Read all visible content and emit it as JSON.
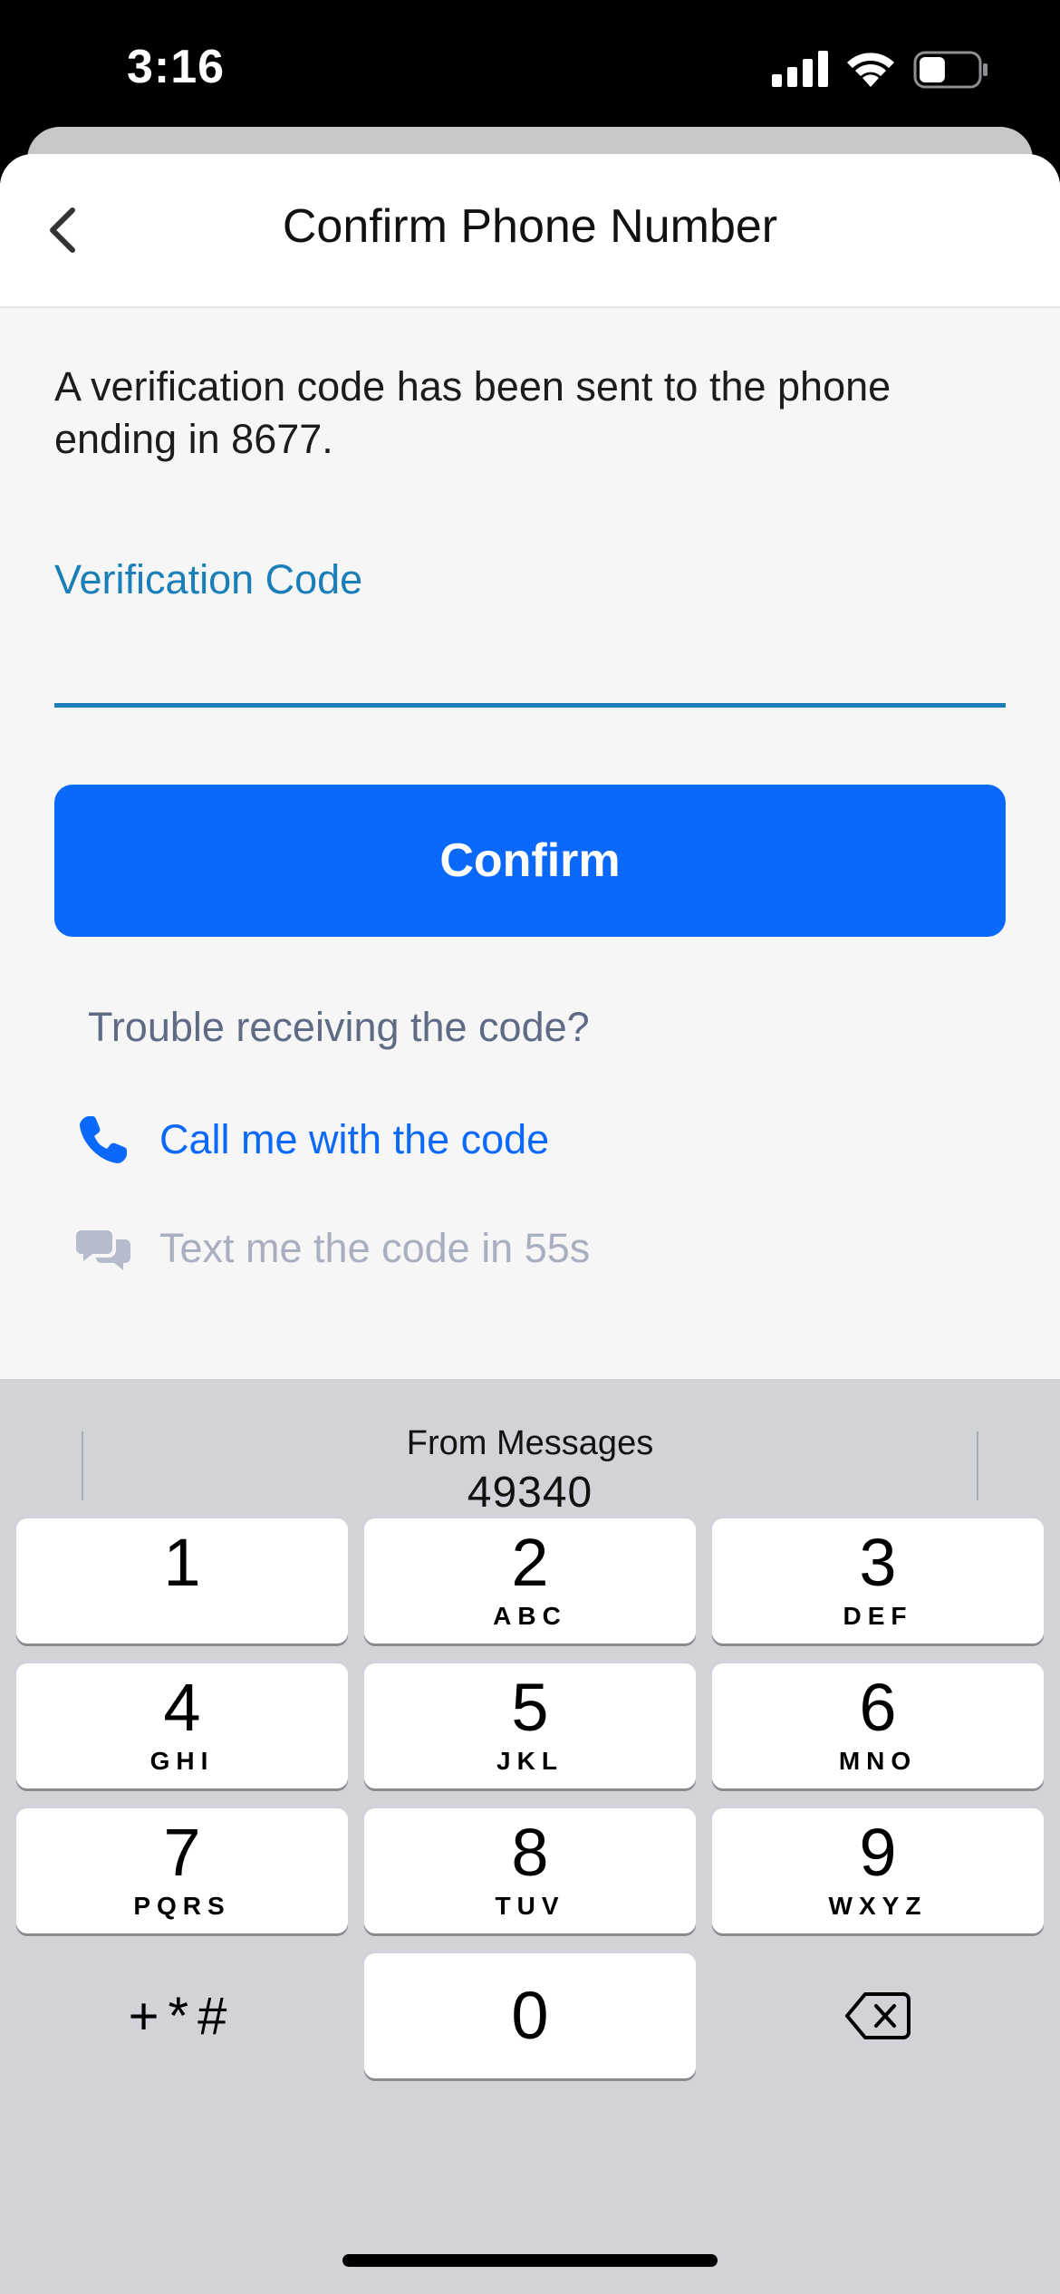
{
  "status_bar": {
    "time": "3:16",
    "battery_percent": 45
  },
  "nav": {
    "title": "Confirm Phone Number"
  },
  "content": {
    "message": "A verification code has been sent to the phone ending in 8677.",
    "field_label": "Verification Code",
    "field_value": "",
    "confirm_label": "Confirm",
    "trouble_text": "Trouble receiving the code?",
    "call_option": "Call me with the code",
    "text_option": "Text me the code in 55s"
  },
  "keyboard": {
    "suggestion_title": "From Messages",
    "suggestion_code": "49340",
    "keys": [
      {
        "digit": "1",
        "letters": ""
      },
      {
        "digit": "2",
        "letters": "ABC"
      },
      {
        "digit": "3",
        "letters": "DEF"
      },
      {
        "digit": "4",
        "letters": "GHI"
      },
      {
        "digit": "5",
        "letters": "JKL"
      },
      {
        "digit": "6",
        "letters": "MNO"
      },
      {
        "digit": "7",
        "letters": "PQRS"
      },
      {
        "digit": "8",
        "letters": "TUV"
      },
      {
        "digit": "9",
        "letters": "WXYZ"
      },
      {
        "digit": "0",
        "letters": ""
      }
    ],
    "symbols_label": "+*#"
  },
  "colors": {
    "accent": "#0a68fa",
    "field_accent": "#1a7fb8",
    "muted_text": "#5f6b85",
    "disabled_text": "#a8afc0",
    "keyboard_bg": "#d1d3d9"
  },
  "icons": [
    "chevron-left-icon",
    "phone-icon",
    "chat-bubbles-icon",
    "delete-backspace-icon",
    "signal-icon",
    "wifi-icon",
    "battery-icon"
  ]
}
